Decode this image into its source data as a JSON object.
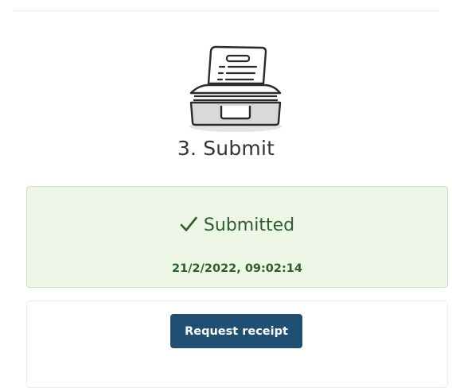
{
  "step": {
    "icon": "document-tray-icon",
    "title": "3. Submit"
  },
  "status": {
    "icon": "check-icon",
    "label": "Submitted",
    "timestamp": "21/2/2022, 09:02:14",
    "colors": {
      "background": "#eef6e8",
      "border": "#cfe0bf",
      "text": "#2f5d2a"
    }
  },
  "actions": {
    "request_receipt_label": "Request receipt",
    "button_color": "#1f4f72"
  }
}
